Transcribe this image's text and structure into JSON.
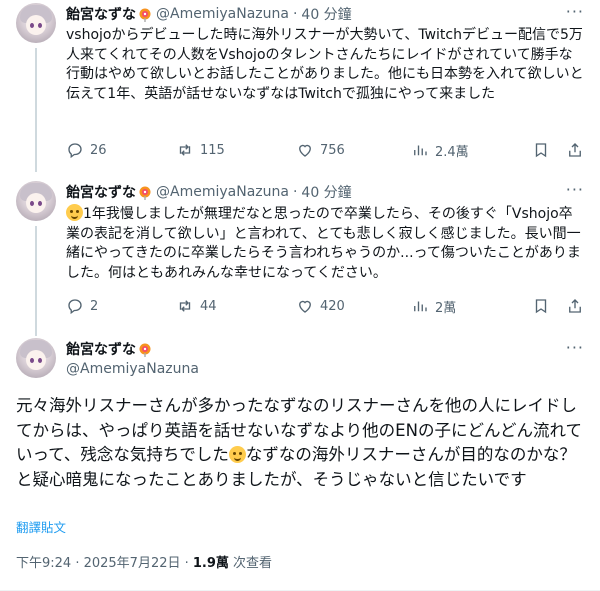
{
  "tweets": [
    {
      "name": "飴宮なずな",
      "handle": "@AmemiyaNazuna",
      "time": "40 分鐘",
      "text": "vshojoからデビューした時に海外リスナーが大勢いて、Twitchデビュー配信で5万人来てくれてその人数をVshojoのタレントさんたちにレイドがされていて勝手な行動はやめて欲しいとお話したことがありました。他にも日本勢を入れて欲しいと伝えて1年、英語が話せないなずなはTwitchで孤独にやって来ました",
      "replies": "26",
      "reposts": "115",
      "likes": "756",
      "views": "2.4萬"
    },
    {
      "name": "飴宮なずな",
      "handle": "@AmemiyaNazuna",
      "time": "40 分鐘",
      "text_after_emoji": "1年我慢しましたが無理だなと思ったので卒業したら、その後すぐ「Vshojo卒業の表記を消して欲しい」と言われて、とても悲しく寂しく感じました。長い間一緒にやってきたのに卒業したらそう言われちゃうのか...って傷ついたことがありました。何はともあれみんな幸せになってください。",
      "replies": "2",
      "reposts": "44",
      "likes": "420",
      "views": "2萬"
    }
  ],
  "main": {
    "name": "飴宮なずな",
    "handle": "@AmemiyaNazuna",
    "text_part1": "元々海外リスナーさんが多かったなずなのリスナーさんを他の人にレイドしてからは、やっぱり英語を話せないなずなより他のENの子にどんどん流れていって、残念な気持ちでした",
    "text_part2": "なずなの海外リスナーさんが目的なのかな？と疑心暗鬼になったことありましたが、そうじゃないと信じたいです",
    "translate": "翻譯貼文",
    "meta_time": "下午9:24 · 2025年7月22日 · ",
    "meta_views": "1.9萬",
    "meta_views_label": " 次查看"
  },
  "colors": {
    "accent": "#1d9bf0",
    "secondary_text": "#536471",
    "thread_line": "#cfd9de"
  },
  "icons": [
    "avatar",
    "lollipop-icon",
    "more-icon",
    "reply-icon",
    "repost-icon",
    "like-icon",
    "views-icon",
    "bookmark-icon",
    "share-icon",
    "smile-emoji"
  ]
}
